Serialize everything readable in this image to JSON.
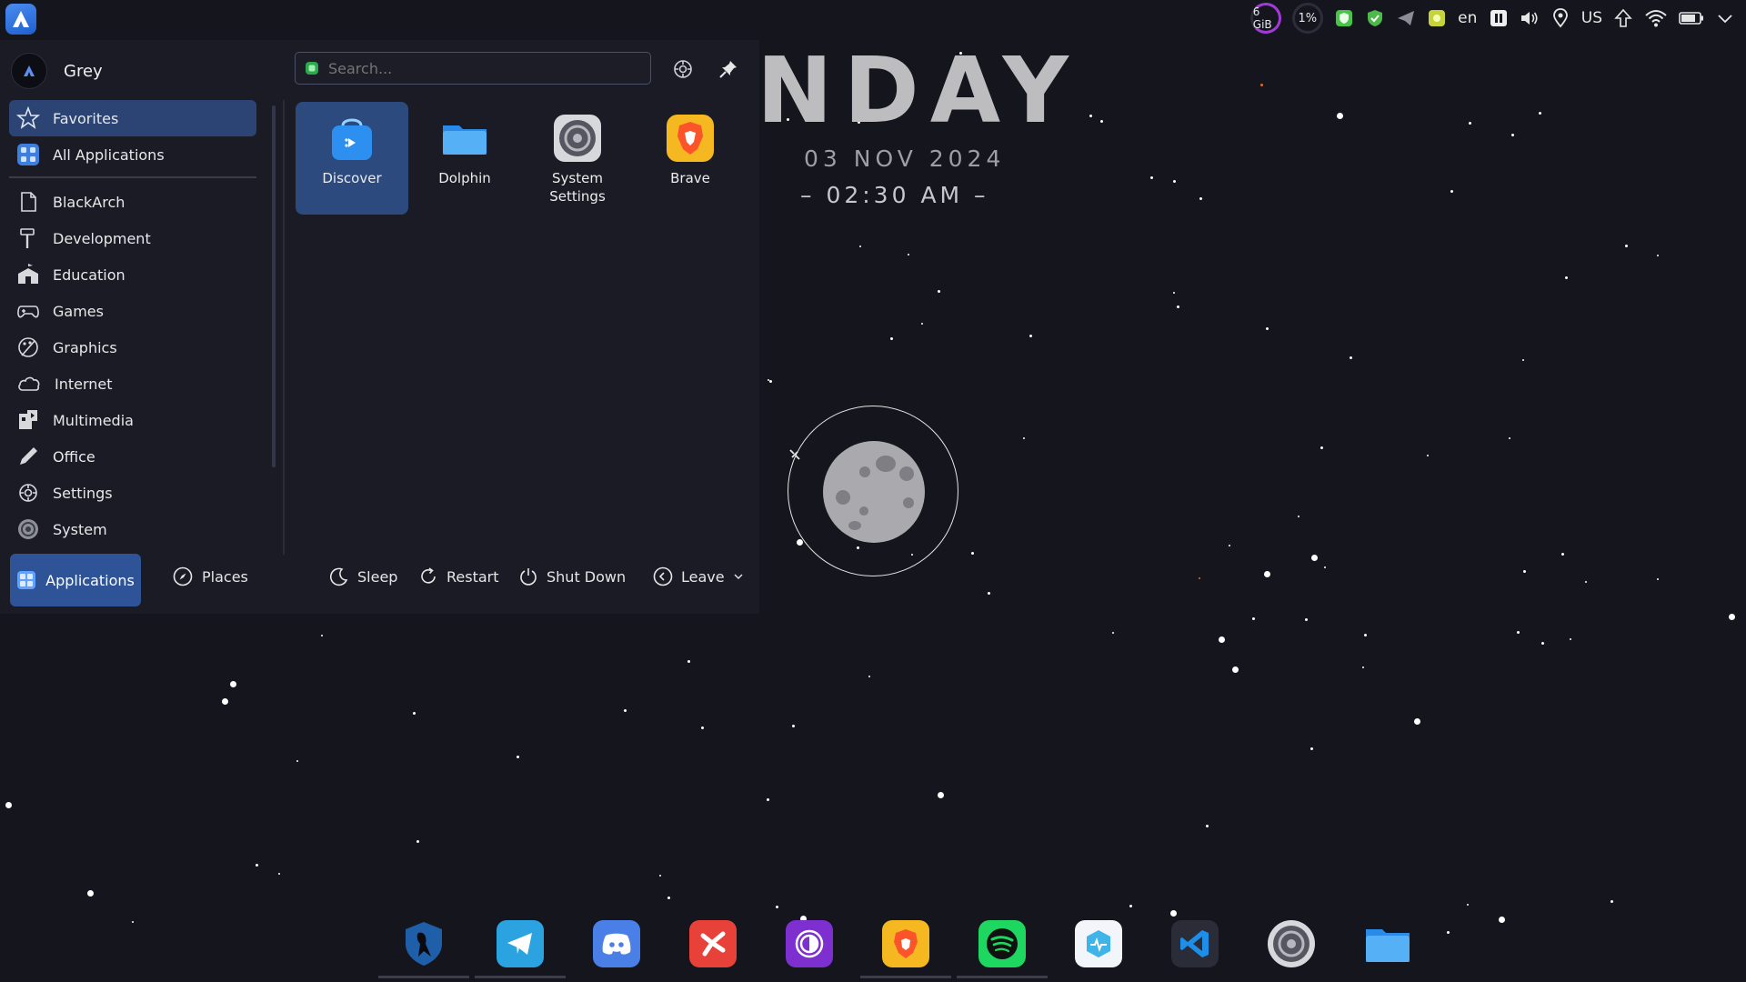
{
  "topbar": {
    "memory": "6 GiB",
    "cpu": "1%",
    "language": "en",
    "keyboard_layout": "US",
    "icons": [
      "shield-green-icon",
      "security-check-icon",
      "telegram-tray-icon",
      "chat-tray-icon",
      "media-pause-icon",
      "volume-icon",
      "location-icon",
      "upload-icon",
      "wifi-icon",
      "battery-icon",
      "chevron-down-icon"
    ]
  },
  "menu": {
    "user_name": "Grey",
    "search_placeholder": "Search...",
    "categories_top": [
      {
        "label": "Favorites",
        "icon": "star-icon"
      },
      {
        "label": "All Applications",
        "icon": "grid-icon"
      }
    ],
    "categories": [
      {
        "label": "BlackArch",
        "icon": "document-icon"
      },
      {
        "label": "Development",
        "icon": "hammer-icon"
      },
      {
        "label": "Education",
        "icon": "school-icon"
      },
      {
        "label": "Games",
        "icon": "gamepad-icon"
      },
      {
        "label": "Graphics",
        "icon": "palette-icon"
      },
      {
        "label": "Internet",
        "icon": "cloud-icon"
      },
      {
        "label": "Multimedia",
        "icon": "multimedia-icon"
      },
      {
        "label": "Office",
        "icon": "pencil-icon"
      },
      {
        "label": "Settings",
        "icon": "gear-icon"
      },
      {
        "label": "System",
        "icon": "system-icon"
      }
    ],
    "favorites": [
      {
        "label": "Discover",
        "icon": "discover-icon"
      },
      {
        "label": "Dolphin",
        "icon": "folder-icon"
      },
      {
        "label": "System Settings",
        "icon": "system-settings-icon"
      },
      {
        "label": "Brave",
        "icon": "brave-icon"
      }
    ],
    "footer": {
      "applications": "Applications",
      "places": "Places",
      "sleep": "Sleep",
      "restart": "Restart",
      "shutdown": "Shut Down",
      "leave": "Leave"
    }
  },
  "clock": {
    "day_fragment": "NDAY",
    "date": "03 NOV 2024",
    "time": "– 02:30 AM –"
  },
  "dock": [
    {
      "name": "blackarch",
      "color": "#1f5ea8"
    },
    {
      "name": "telegram",
      "color": "#2aa3e0"
    },
    {
      "name": "discord",
      "color": "#4a7fe8"
    },
    {
      "name": "xmind",
      "color": "#e8413a"
    },
    {
      "name": "tor-browser",
      "color": "#7d2fd0"
    },
    {
      "name": "brave",
      "color": "#f0a51c"
    },
    {
      "name": "spotify",
      "color": "#1ed760"
    },
    {
      "name": "health-monitor",
      "color": "#f2f6fb"
    },
    {
      "name": "vscode",
      "color": "#2a2c38"
    },
    {
      "name": "system-settings",
      "color": "#6f7076"
    },
    {
      "name": "dolphin",
      "color": "#2f8be8"
    }
  ],
  "colors": {
    "background": "#14151d",
    "menu_bg": "#1a1b25",
    "accent": "#2e5396",
    "selection": "#2c4473"
  }
}
